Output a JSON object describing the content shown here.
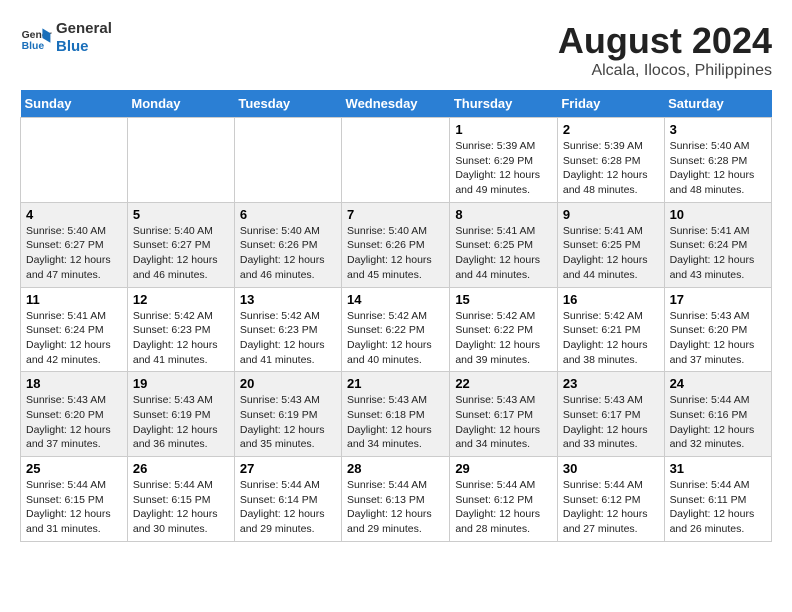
{
  "header": {
    "logo_general": "General",
    "logo_blue": "Blue",
    "main_title": "August 2024",
    "sub_title": "Alcala, Ilocos, Philippines"
  },
  "weekdays": [
    "Sunday",
    "Monday",
    "Tuesday",
    "Wednesday",
    "Thursday",
    "Friday",
    "Saturday"
  ],
  "weeks": [
    [
      {
        "day": "",
        "info": ""
      },
      {
        "day": "",
        "info": ""
      },
      {
        "day": "",
        "info": ""
      },
      {
        "day": "",
        "info": ""
      },
      {
        "day": "1",
        "info": "Sunrise: 5:39 AM\nSunset: 6:29 PM\nDaylight: 12 hours\nand 49 minutes."
      },
      {
        "day": "2",
        "info": "Sunrise: 5:39 AM\nSunset: 6:28 PM\nDaylight: 12 hours\nand 48 minutes."
      },
      {
        "day": "3",
        "info": "Sunrise: 5:40 AM\nSunset: 6:28 PM\nDaylight: 12 hours\nand 48 minutes."
      }
    ],
    [
      {
        "day": "4",
        "info": "Sunrise: 5:40 AM\nSunset: 6:27 PM\nDaylight: 12 hours\nand 47 minutes."
      },
      {
        "day": "5",
        "info": "Sunrise: 5:40 AM\nSunset: 6:27 PM\nDaylight: 12 hours\nand 46 minutes."
      },
      {
        "day": "6",
        "info": "Sunrise: 5:40 AM\nSunset: 6:26 PM\nDaylight: 12 hours\nand 46 minutes."
      },
      {
        "day": "7",
        "info": "Sunrise: 5:40 AM\nSunset: 6:26 PM\nDaylight: 12 hours\nand 45 minutes."
      },
      {
        "day": "8",
        "info": "Sunrise: 5:41 AM\nSunset: 6:25 PM\nDaylight: 12 hours\nand 44 minutes."
      },
      {
        "day": "9",
        "info": "Sunrise: 5:41 AM\nSunset: 6:25 PM\nDaylight: 12 hours\nand 44 minutes."
      },
      {
        "day": "10",
        "info": "Sunrise: 5:41 AM\nSunset: 6:24 PM\nDaylight: 12 hours\nand 43 minutes."
      }
    ],
    [
      {
        "day": "11",
        "info": "Sunrise: 5:41 AM\nSunset: 6:24 PM\nDaylight: 12 hours\nand 42 minutes."
      },
      {
        "day": "12",
        "info": "Sunrise: 5:42 AM\nSunset: 6:23 PM\nDaylight: 12 hours\nand 41 minutes."
      },
      {
        "day": "13",
        "info": "Sunrise: 5:42 AM\nSunset: 6:23 PM\nDaylight: 12 hours\nand 41 minutes."
      },
      {
        "day": "14",
        "info": "Sunrise: 5:42 AM\nSunset: 6:22 PM\nDaylight: 12 hours\nand 40 minutes."
      },
      {
        "day": "15",
        "info": "Sunrise: 5:42 AM\nSunset: 6:22 PM\nDaylight: 12 hours\nand 39 minutes."
      },
      {
        "day": "16",
        "info": "Sunrise: 5:42 AM\nSunset: 6:21 PM\nDaylight: 12 hours\nand 38 minutes."
      },
      {
        "day": "17",
        "info": "Sunrise: 5:43 AM\nSunset: 6:20 PM\nDaylight: 12 hours\nand 37 minutes."
      }
    ],
    [
      {
        "day": "18",
        "info": "Sunrise: 5:43 AM\nSunset: 6:20 PM\nDaylight: 12 hours\nand 37 minutes."
      },
      {
        "day": "19",
        "info": "Sunrise: 5:43 AM\nSunset: 6:19 PM\nDaylight: 12 hours\nand 36 minutes."
      },
      {
        "day": "20",
        "info": "Sunrise: 5:43 AM\nSunset: 6:19 PM\nDaylight: 12 hours\nand 35 minutes."
      },
      {
        "day": "21",
        "info": "Sunrise: 5:43 AM\nSunset: 6:18 PM\nDaylight: 12 hours\nand 34 minutes."
      },
      {
        "day": "22",
        "info": "Sunrise: 5:43 AM\nSunset: 6:17 PM\nDaylight: 12 hours\nand 34 minutes."
      },
      {
        "day": "23",
        "info": "Sunrise: 5:43 AM\nSunset: 6:17 PM\nDaylight: 12 hours\nand 33 minutes."
      },
      {
        "day": "24",
        "info": "Sunrise: 5:44 AM\nSunset: 6:16 PM\nDaylight: 12 hours\nand 32 minutes."
      }
    ],
    [
      {
        "day": "25",
        "info": "Sunrise: 5:44 AM\nSunset: 6:15 PM\nDaylight: 12 hours\nand 31 minutes."
      },
      {
        "day": "26",
        "info": "Sunrise: 5:44 AM\nSunset: 6:15 PM\nDaylight: 12 hours\nand 30 minutes."
      },
      {
        "day": "27",
        "info": "Sunrise: 5:44 AM\nSunset: 6:14 PM\nDaylight: 12 hours\nand 29 minutes."
      },
      {
        "day": "28",
        "info": "Sunrise: 5:44 AM\nSunset: 6:13 PM\nDaylight: 12 hours\nand 29 minutes."
      },
      {
        "day": "29",
        "info": "Sunrise: 5:44 AM\nSunset: 6:12 PM\nDaylight: 12 hours\nand 28 minutes."
      },
      {
        "day": "30",
        "info": "Sunrise: 5:44 AM\nSunset: 6:12 PM\nDaylight: 12 hours\nand 27 minutes."
      },
      {
        "day": "31",
        "info": "Sunrise: 5:44 AM\nSunset: 6:11 PM\nDaylight: 12 hours\nand 26 minutes."
      }
    ]
  ]
}
